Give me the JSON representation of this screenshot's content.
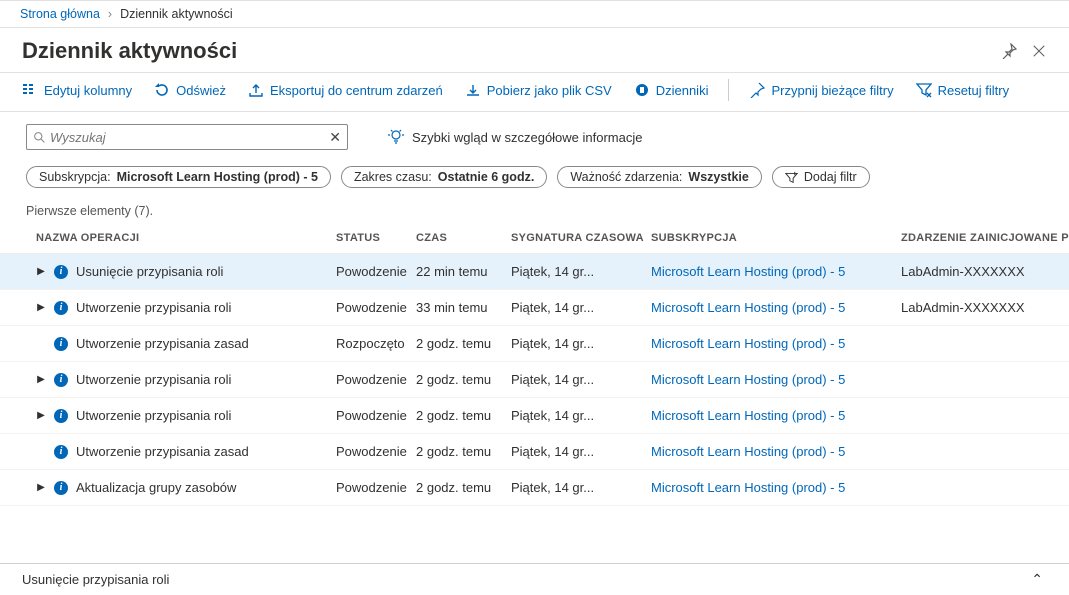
{
  "breadcrumb": {
    "home": "Strona główna",
    "current": "Dziennik aktywności"
  },
  "title": "Dziennik aktywności",
  "toolbar": {
    "edit_columns": "Edytuj kolumny",
    "refresh": "Odśwież",
    "export_hub": "Eksportuj do centrum zdarzeń",
    "download_csv": "Pobierz jako plik CSV",
    "logs": "Dzienniki",
    "pin": "Przypnij bieżące filtry",
    "reset": "Resetuj filtry"
  },
  "search": {
    "placeholder": "Wyszukaj"
  },
  "insights": "Szybki wgląd w szczegółowe informacje",
  "filters": {
    "subscription_label": "Subskrypcja: ",
    "subscription_value": "Microsoft Learn Hosting (prod) - 5",
    "timerange_label": "Zakres czasu: ",
    "timerange_value": "Ostatnie 6 godz.",
    "severity_label": "Ważność zdarzenia: ",
    "severity_value": "Wszystkie",
    "add_filter": "Dodaj filtr"
  },
  "summary": "Pierwsze elementy (7).",
  "columns": {
    "op": "NAZWA OPERACJI",
    "status": "STATUS",
    "time": "CZAS",
    "timestamp": "SYGNATURA CZASOWA",
    "sub": "SUBSKRYPCJA",
    "initiated": "ZDARZENIE ZAINICJOWANE PRZEZ"
  },
  "rows": [
    {
      "caret": true,
      "op": "Usunięcie przypisania roli",
      "status": "Powodzenie",
      "time": "22 min temu",
      "ts": "Piątek, 14 gr...",
      "sub": "Microsoft Learn Hosting (prod) - 5",
      "by": "LabAdmin-XXXXXXX",
      "selected": true
    },
    {
      "caret": true,
      "op": "Utworzenie przypisania roli",
      "status": "Powodzenie",
      "time": "33 min temu",
      "ts": "Piątek, 14 gr...",
      "sub": "Microsoft Learn Hosting (prod) - 5",
      "by": "LabAdmin-XXXXXXX"
    },
    {
      "caret": false,
      "op": "Utworzenie przypisania zasad",
      "status": "Rozpoczęto",
      "time": "2 godz. temu",
      "ts": "Piątek, 14 gr...",
      "sub": "Microsoft Learn Hosting (prod) - 5",
      "by": ""
    },
    {
      "caret": true,
      "op": "Utworzenie przypisania roli",
      "status": "Powodzenie",
      "time": "2 godz. temu",
      "ts": "Piątek, 14 gr...",
      "sub": "Microsoft Learn Hosting (prod) - 5",
      "by": ""
    },
    {
      "caret": true,
      "op": "Utworzenie przypisania roli",
      "status": "Powodzenie",
      "time": "2 godz. temu",
      "ts": "Piątek, 14 gr...",
      "sub": "Microsoft Learn Hosting (prod) - 5",
      "by": ""
    },
    {
      "caret": false,
      "op": "Utworzenie przypisania zasad",
      "status": "Powodzenie",
      "time": "2 godz. temu",
      "ts": "Piątek, 14 gr...",
      "sub": "Microsoft Learn Hosting (prod) - 5",
      "by": ""
    },
    {
      "caret": true,
      "op": "Aktualizacja grupy zasobów",
      "status": "Powodzenie",
      "time": "2 godz. temu",
      "ts": "Piątek, 14 gr...",
      "sub": "Microsoft Learn Hosting (prod) - 5",
      "by": ""
    }
  ],
  "bottom": "Usunięcie przypisania roli"
}
